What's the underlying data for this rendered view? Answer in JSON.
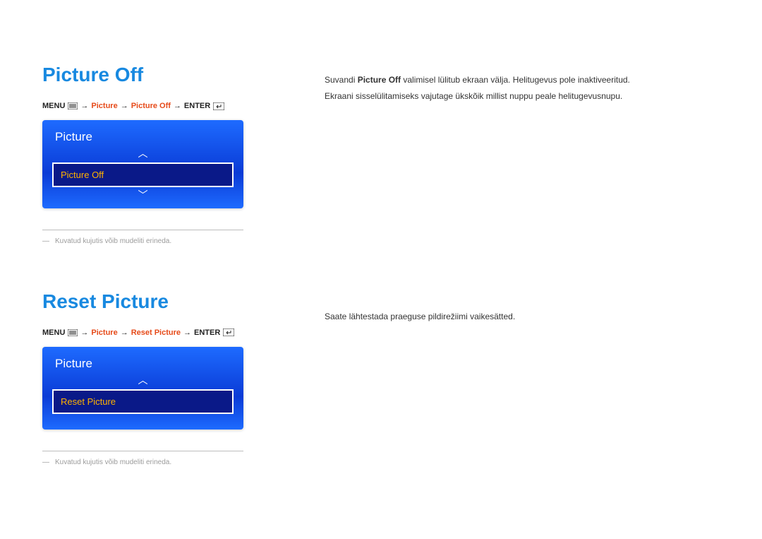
{
  "section1": {
    "heading": "Picture Off",
    "breadcrumb": {
      "menu": "MENU",
      "picture": "Picture",
      "picture_off": "Picture Off",
      "enter": "ENTER"
    },
    "osd": {
      "title": "Picture",
      "selected": "Picture Off"
    },
    "footnote": "Kuvatud kujutis võib mudeliti erineda.",
    "body": {
      "pre": "Suvandi ",
      "bold": "Picture Off",
      "post": " valimisel lülitub ekraan välja. Helitugevus pole inaktiveeritud.",
      "line2": "Ekraani sisselülitamiseks vajutage ükskõik millist nuppu peale helitugevusnupu."
    }
  },
  "section2": {
    "heading": "Reset Picture",
    "breadcrumb": {
      "menu": "MENU",
      "picture": "Picture",
      "reset_picture": "Reset Picture",
      "enter": "ENTER"
    },
    "osd": {
      "title": "Picture",
      "selected": "Reset Picture"
    },
    "footnote": "Kuvatud kujutis võib mudeliti erineda.",
    "body": "Saate lähtestada praeguse pildirežiimi vaikesätted."
  },
  "glyphs": {
    "arrow_right": "→",
    "chevron_up": "︿",
    "chevron_down": "﹀",
    "footnote_dash": "―"
  }
}
